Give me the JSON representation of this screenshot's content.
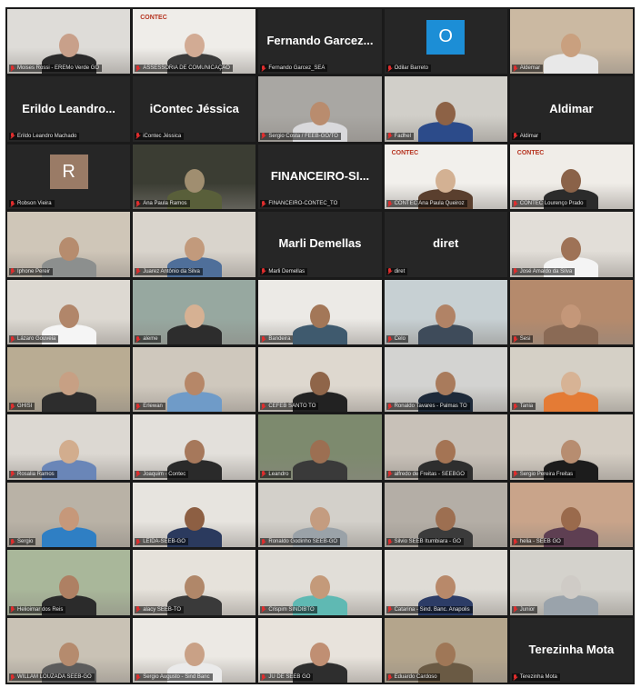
{
  "tiles": [
    {
      "name": "Moises Rossi - EREMo Verde GO",
      "display": "",
      "kind": "video",
      "bg": "#dedcd8",
      "skin": "#c8a08a",
      "shirt": "#2a2a2a"
    },
    {
      "name": "ASSESSORIA DE COMUNICAÇÃO",
      "display": "",
      "kind": "video",
      "bg": "#efede9",
      "skin": "#d2ab94",
      "shirt": "#3a3a3a",
      "logo": "CONTEC"
    },
    {
      "name": "Fernando Garcez_SEA",
      "display": "Fernando Garcez...",
      "kind": "name"
    },
    {
      "name": "Odilar Barreto",
      "display": "",
      "kind": "avatar",
      "avatar": "O",
      "avatar_color": "#1c8ed6"
    },
    {
      "name": "Aldemar",
      "display": "",
      "kind": "video",
      "bg": "#cbb9a2",
      "skin": "#c9a07f",
      "shirt": "#e8e8e8"
    },
    {
      "name": "Erildo Leandro Machado",
      "display": "Erildo Leandro...",
      "kind": "name"
    },
    {
      "name": "iContec Jéssica",
      "display": "iContec Jéssica",
      "kind": "name"
    },
    {
      "name": "Sergio Costa / FEEB-GO/TO",
      "display": "",
      "kind": "video",
      "bg": "#a9a7a3",
      "skin": "#b98c6e",
      "shirt": "#d9d9dc"
    },
    {
      "name": "Fadhel",
      "display": "",
      "kind": "video",
      "bg": "#d1cfc9",
      "skin": "#8d6246",
      "shirt": "#2c4b8a"
    },
    {
      "name": "Aldimar",
      "display": "Aldimar",
      "kind": "name"
    },
    {
      "name": "Robson Vieira",
      "display": "",
      "kind": "avatar",
      "avatar": "R",
      "avatar_color": "#9a7b66"
    },
    {
      "name": "Ana Paula Ramos",
      "display": "",
      "kind": "video",
      "bg": "#3b3d33",
      "skin": "#a08e70",
      "shirt": "#595f3a"
    },
    {
      "name": "FINANCEIRO-CONTEC_TO",
      "display": "FINANCEIRO-SI...",
      "kind": "name"
    },
    {
      "name": "CONTEC Ana Paula Queiroz",
      "display": "",
      "kind": "video",
      "bg": "#f2f0ec",
      "skin": "#d3b193",
      "shirt": "#5a3f2e",
      "logo": "CONTEC"
    },
    {
      "name": "CONTEC Lourenço Prado",
      "display": "",
      "kind": "video",
      "bg": "#f0ede8",
      "skin": "#8a6248",
      "shirt": "#2b2b2b",
      "logo": "CONTEC"
    },
    {
      "name": "Iphone Pereir",
      "display": "",
      "kind": "video",
      "bg": "#cfc6b8",
      "skin": "#b68c6e",
      "shirt": "#8c8f8e"
    },
    {
      "name": "Juarez Antônio da Silva",
      "display": "",
      "kind": "video",
      "bg": "#d9d4cc",
      "skin": "#c29a7c",
      "shirt": "#4f6f9a"
    },
    {
      "name": "Marli Demellas",
      "display": "Marli Demellas",
      "kind": "name"
    },
    {
      "name": "diret",
      "display": "diret",
      "kind": "name"
    },
    {
      "name": "José Amaldo da Silva",
      "display": "",
      "kind": "video",
      "bg": "#e2ded8",
      "skin": "#9e7256",
      "shirt": "#f4f4f4"
    },
    {
      "name": "Lázaro Gouveia",
      "display": "",
      "kind": "video",
      "bg": "#ddd9d2",
      "skin": "#b1866a",
      "shirt": "#f5f5f5"
    },
    {
      "name": "aleme",
      "display": "",
      "kind": "video",
      "bg": "#97a8a0",
      "skin": "#d6b193",
      "shirt": "#2d2d2d"
    },
    {
      "name": "Bandeira",
      "display": "",
      "kind": "video",
      "bg": "#eceae6",
      "skin": "#a37758",
      "shirt": "#3f5a6e"
    },
    {
      "name": "Celo",
      "display": "",
      "kind": "video",
      "bg": "#c7d0d3",
      "skin": "#b18366",
      "shirt": "#3e4b5a"
    },
    {
      "name": "Sesi",
      "display": "",
      "kind": "video",
      "bg": "#b58a6c",
      "skin": "#c49779",
      "shirt": "#8a6a55"
    },
    {
      "name": "GHISI",
      "display": "",
      "kind": "video",
      "bg": "#b9ac93",
      "skin": "#c7a084",
      "shirt": "#2d2d2d"
    },
    {
      "name": "Erlewan",
      "display": "",
      "kind": "video",
      "bg": "#cfc8bd",
      "skin": "#b68768",
      "shirt": "#6f9bc8"
    },
    {
      "name": "CEFEB SANTO TO",
      "display": "",
      "kind": "video",
      "bg": "#ded8cf",
      "skin": "#8f6549",
      "shirt": "#222222"
    },
    {
      "name": "Ronaldo Tavares - Palmas TO",
      "display": "",
      "kind": "video",
      "bg": "#d3d3d1",
      "skin": "#a97b5c",
      "shirt": "#1e2a3a"
    },
    {
      "name": "Tania",
      "display": "",
      "kind": "video",
      "bg": "#d5d0c6",
      "skin": "#d7b395",
      "shirt": "#e47b35"
    },
    {
      "name": "Rosalia Ramos",
      "display": "",
      "kind": "video",
      "bg": "#dcd8d2",
      "skin": "#d2ad8e",
      "shirt": "#6a86b8"
    },
    {
      "name": "Joaquim - Contec",
      "display": "",
      "kind": "video",
      "bg": "#e3e0db",
      "skin": "#a6785b",
      "shirt": "#2a2a2a"
    },
    {
      "name": "Leandro",
      "display": "",
      "kind": "video",
      "bg": "#7d8a6e",
      "skin": "#9c6f52",
      "shirt": "#3a3a3a"
    },
    {
      "name": "alfredo de Freitas - SEEBGO",
      "display": "",
      "kind": "video",
      "bg": "#c8c1b8",
      "skin": "#a47454",
      "shirt": "#2e2e2e"
    },
    {
      "name": "Sergio Pereira Freitas",
      "display": "",
      "kind": "video",
      "bg": "#d4cdc3",
      "skin": "#b78d70",
      "shirt": "#1c1c1c"
    },
    {
      "name": "Sergio",
      "display": "",
      "kind": "video",
      "bg": "#b9b2a6",
      "skin": "#c6987a",
      "shirt": "#2f7fc4"
    },
    {
      "name": "LEIDA-SEEB-GO",
      "display": "",
      "kind": "video",
      "bg": "#e7e4df",
      "skin": "#8d5f43",
      "shirt": "#2b3a5e"
    },
    {
      "name": "Ronaldo Godinho SEEB-GO",
      "display": "",
      "kind": "video",
      "bg": "#d3d0ca",
      "skin": "#c49c80",
      "shirt": "#9aa2a8"
    },
    {
      "name": "Silvio SEEB Itumbiara - GO",
      "display": "",
      "kind": "video",
      "bg": "#b4aea6",
      "skin": "#9d6f51",
      "shirt": "#3b3b3b"
    },
    {
      "name": "helia - SEEB GO",
      "display": "",
      "kind": "video",
      "bg": "#c9a48a",
      "skin": "#9a6a4c",
      "shirt": "#5e3f52"
    },
    {
      "name": "Helioimar dos Reis",
      "display": "",
      "kind": "video",
      "bg": "#a9b79a",
      "skin": "#ae8063",
      "shirt": "#2b2b2b"
    },
    {
      "name": "alacy SEEB-TO",
      "display": "",
      "kind": "video",
      "bg": "#e6e2db",
      "skin": "#b08769",
      "shirt": "#3a3a3a"
    },
    {
      "name": "Crispim SINDIBTO",
      "display": "",
      "kind": "video",
      "bg": "#e1ded8",
      "skin": "#c49a7a",
      "shirt": "#5fb9b3"
    },
    {
      "name": "Catarina - Sind. Banc. Anapolis",
      "display": "",
      "kind": "video",
      "bg": "#dfdcd6",
      "skin": "#b8896a",
      "shirt": "#2c3c66"
    },
    {
      "name": "Junior",
      "display": "",
      "kind": "video",
      "bg": "#d4d2cc",
      "skin": "#cfcbc6",
      "shirt": "#9aa3ab"
    },
    {
      "name": "WILLAM LOUZADA SEEB-GO",
      "display": "",
      "kind": "video",
      "bg": "#c9c2b5",
      "skin": "#b58b6e",
      "shirt": "#5c5c5c"
    },
    {
      "name": "Sergio Augusto - Sind Banc",
      "display": "",
      "kind": "video",
      "bg": "#ece9e4",
      "skin": "#c9a186",
      "shirt": "#eaeaea"
    },
    {
      "name": "JU DE SEEB GO",
      "display": "",
      "kind": "video",
      "bg": "#e8e3dc",
      "skin": "#c08f73",
      "shirt": "#2e2e2e"
    },
    {
      "name": "Eduardo Cardoso",
      "display": "",
      "kind": "video",
      "bg": "#b4a58c",
      "skin": "#9f7757",
      "shirt": "#6a5a44"
    },
    {
      "name": "Terezinha Mota",
      "display": "Terezinha Mota",
      "kind": "name"
    }
  ]
}
